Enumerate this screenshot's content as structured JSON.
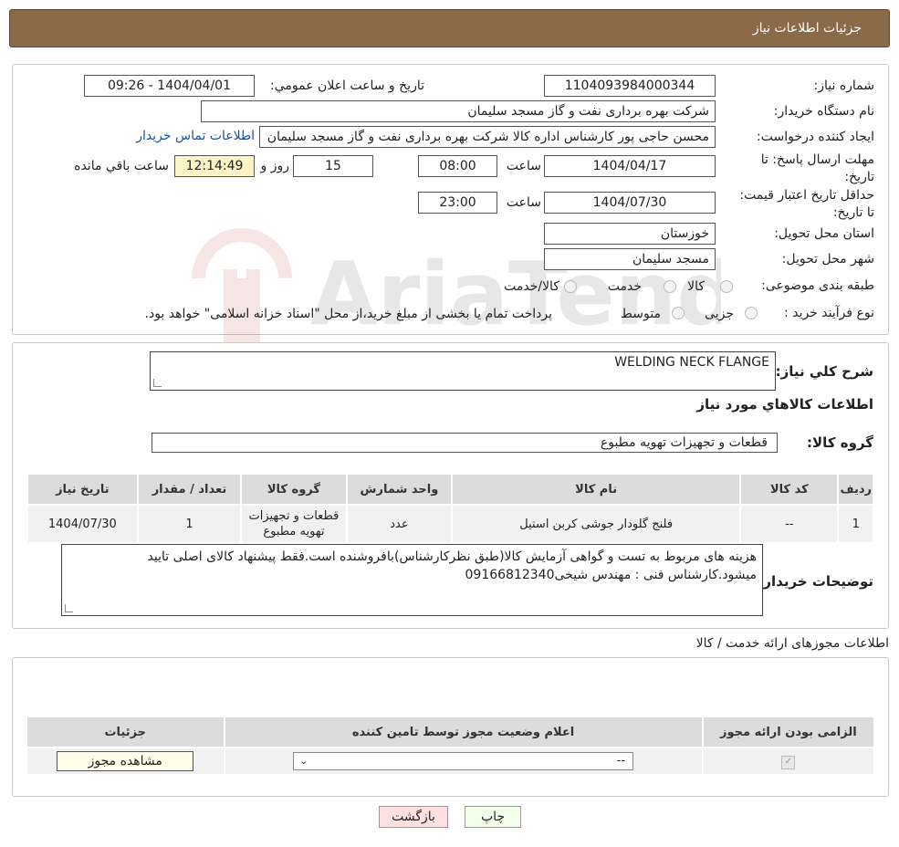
{
  "header": {
    "title": "جزئيات اطلاعات نياز"
  },
  "form": {
    "need_number_label": "شماره نياز:",
    "need_number": "1104093984000344",
    "announce_label": "تاريخ و ساعت اعلان عمومي:",
    "announce_value": "1404/04/01 - 09:26",
    "buyer_org_label": "نام دستگاه خريدار:",
    "buyer_org": "شرکت بهره برداری نفت و گاز مسجد سلیمان",
    "requester_label": "ايجاد کننده درخواست:",
    "requester": "محسن حاجی پور کارشناس اداره کالا  شرکت بهره برداری نفت و گاز مسجد سلیمان",
    "contact_link": "اطلاعات تماس خريدار",
    "deadline_label": "مهلت ارسال پاسخ: تا تاريخ:",
    "deadline_date": "1404/04/17",
    "time_label": "ساعت",
    "deadline_time": "08:00",
    "days_value": "15",
    "days_label": "روز و",
    "remaining_time": "12:14:49",
    "remaining_label": "ساعت باقي مانده",
    "validity_label": "حداقل تاريخ اعتبار قيمت: تا تاريخ:",
    "validity_date": "1404/07/30",
    "validity_time": "23:00",
    "province_label": "استان محل تحويل:",
    "province": "خوزستان",
    "city_label": "شهر محل تحويل:",
    "city": "مسجد سلیمان",
    "category_label": "طبقه بندی موضوعی:",
    "category_options": [
      "کالا",
      "خدمت",
      "کالا/خدمت"
    ],
    "purchase_type_label": "نوع فرآيند خريد :",
    "purchase_options": [
      "جزیی",
      "متوسط"
    ],
    "purchase_note": "پرداخت تمام يا بخشی از مبلغ خريد،از محل \"اسناد خزانه اسلامی\" خواهد بود."
  },
  "summary": {
    "desc_label": "شرح کلي نياز:",
    "desc_value": "WELDING NECK FLANGE",
    "items_title": "اطلاعات کالاهاي مورد نياز",
    "group_label": "گروه کالا:",
    "group_value": "قطعات و تجهیزات تهویه مطبوع"
  },
  "items_table": {
    "headers": [
      "رديف",
      "کد کالا",
      "نام کالا",
      "واحد شمارش",
      "گروه کالا",
      "تعداد / مقدار",
      "تاريخ نياز"
    ],
    "rows": [
      {
        "row": "1",
        "code": "--",
        "name": "فلنج گلودار جوشی کربن استیل",
        "unit": "عدد",
        "group": "قطعات و تجهیزات تهویه مطبوع",
        "qty": "1",
        "date": "1404/07/30"
      }
    ]
  },
  "buyer_notes": {
    "label": "توضيحات خريدار:",
    "text": "هزینه های مربوط به تست و گواهی آزمایش کالا(طبق نظرکارشناس)بافروشنده است.فقط پیشنهاد کالای اصلی تایید میشود.کارشناس فنی : مهندس شیخی09166812340"
  },
  "permits": {
    "title": "اطلاعات مجوزهای ارائه خدمت / کالا",
    "headers": [
      "الزامی بودن ارائه مجوز",
      "اعلام وضعیت مجوز توسط تامین کننده",
      "جزئیات"
    ],
    "select_value": "--",
    "view_button": "مشاهده مجوز"
  },
  "footer": {
    "print_button": "چاپ",
    "back_button": "بازگشت"
  },
  "watermark_text": "AriaTender.neT"
}
